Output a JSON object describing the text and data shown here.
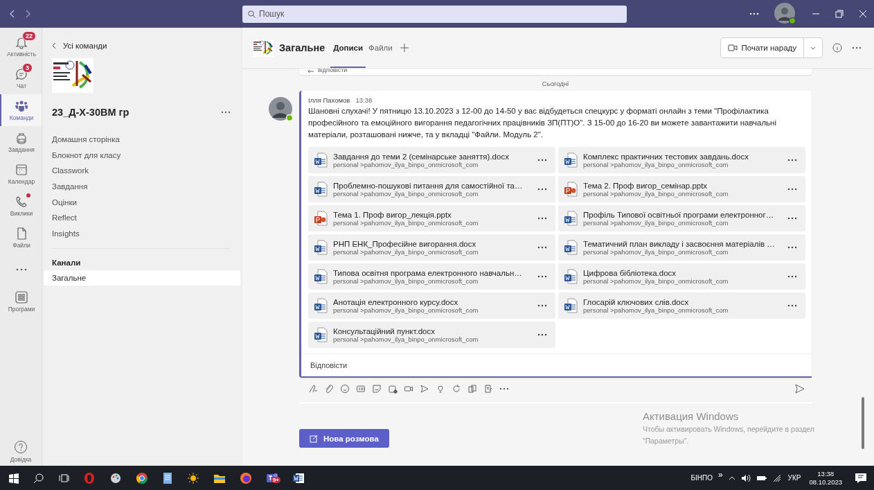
{
  "titlebar": {
    "search_placeholder": "Пошук"
  },
  "rail": {
    "items": [
      {
        "label": "Активність",
        "kind": "bell",
        "badge": "22",
        "notification": false,
        "selected": false
      },
      {
        "label": "Чат",
        "kind": "chat",
        "badge": "3",
        "notification": false,
        "selected": false
      },
      {
        "label": "Команди",
        "kind": "teams",
        "notification": false,
        "selected": true
      },
      {
        "label": "Завдання",
        "kind": "bag",
        "notification": false,
        "selected": false
      },
      {
        "label": "Календар",
        "kind": "calendar",
        "notification": false,
        "selected": false
      },
      {
        "label": "Виклики",
        "kind": "phone",
        "notification": true,
        "selected": false
      },
      {
        "label": "Файли",
        "kind": "file",
        "notification": false,
        "selected": false
      },
      {
        "kind": "more",
        "notification": false,
        "selected": false
      },
      {
        "label": "Програми",
        "kind": "apps",
        "notification": false,
        "selected": false
      }
    ],
    "help": "Довідка"
  },
  "sidebar": {
    "back_link": "Усі команди",
    "team_name": "23_Д-Х-30ВМ гр",
    "nav": [
      "Домашня сторінка",
      "Блокнот для класу",
      "Classwork",
      "Завдання",
      "Оцінки",
      "Reflect",
      "Insights"
    ],
    "channels_heading": "Канали",
    "channels": [
      {
        "label": "Загальне",
        "selected": true
      }
    ]
  },
  "header": {
    "channel_name": "Загальне",
    "tabs": [
      {
        "label": "Дописи",
        "selected": true
      },
      {
        "label": "Файли",
        "selected": false
      }
    ],
    "meet_button": "Почати нараду"
  },
  "feed": {
    "previous_reply": "відповісти",
    "date_divider": "Сьогодні",
    "message": {
      "author": "Ілля Пахомов",
      "time": "13:38",
      "text": "Шановні слухачі! У пятницю 13.10.2023 з 12-00 до 14-50 у вас відбудеться спецкурс у форматі онлайн з теми \"Профілактика професійного та емоційного вигорання педагогічних працівників ЗП(ПТ)О\". З 15-00 до 16-20 ви можете завантажити навчальні матеріали, розташовані нижче, та у вкладці \"Файли. Модуль 2\".",
      "attachments": [
        {
          "name": "Завдання до теми 2 (семінарське заняття).docx",
          "path": "personal >pahomov_ilya_binpo_onmicrosoft_com",
          "kind": "word"
        },
        {
          "name": "Комплекс практичних тестових завдань.docx",
          "path": "personal >pahomov_ilya_binpo_onmicrosoft_com",
          "kind": "word"
        },
        {
          "name": "Проблемно-пошукові питання для самостійної та…",
          "path": "personal >pahomov_ilya_binpo_onmicrosoft_com",
          "kind": "word"
        },
        {
          "name": "Тема 2. Проф вигор_семінар.pptx",
          "path": "personal >pahomov_ilya_binpo_onmicrosoft_com",
          "kind": "powerpoint"
        },
        {
          "name": "Тема 1. Проф вигор_лекція.pptx",
          "path": "personal >pahomov_ilya_binpo_onmicrosoft_com",
          "kind": "powerpoint"
        },
        {
          "name": "Профіль Типової освітньої програми електронног…",
          "path": "personal >pahomov_ilya_binpo_onmicrosoft_com",
          "kind": "word"
        },
        {
          "name": "РНП ЕНК_Професійне вигорання.docx",
          "path": "personal >pahomov_ilya_binpo_onmicrosoft_com",
          "kind": "word"
        },
        {
          "name": "Тематичний план викладу і засвоєння матеріалів …",
          "path": "personal >pahomov_ilya_binpo_onmicrosoft_com",
          "kind": "word"
        },
        {
          "name": "Типова освітня програма електронного навчальн…",
          "path": "personal >pahomov_ilya_binpo_onmicrosoft_com",
          "kind": "word"
        },
        {
          "name": "Цифрова бібліотека.docx",
          "path": "personal >pahomov_ilya_binpo_onmicrosoft_com",
          "kind": "word"
        },
        {
          "name": "Анотація електронного курсу.docx",
          "path": "personal >pahomov_ilya_binpo_onmicrosoft_com",
          "kind": "word"
        },
        {
          "name": "Глосарій ключових слів.docx",
          "path": "personal >pahomov_ilya_binpo_onmicrosoft_com",
          "kind": "word"
        },
        {
          "name": "Консультаційний пункт.docx",
          "path": "personal >pahomov_ilya_binpo_onmicrosoft_com",
          "kind": "word"
        }
      ],
      "reply": "Відповісти"
    },
    "new_conversation": "Нова розмова"
  },
  "activation": {
    "title": "Активация Windows",
    "text": "Чтобы активировать Windows, перейдите в раздел \"Параметры\"."
  },
  "taskbar": {
    "teams_badge": "9+",
    "user": "БІНПО",
    "overflow": "»",
    "language": "УКР",
    "time": "13:38",
    "date": "08.10.2023"
  }
}
